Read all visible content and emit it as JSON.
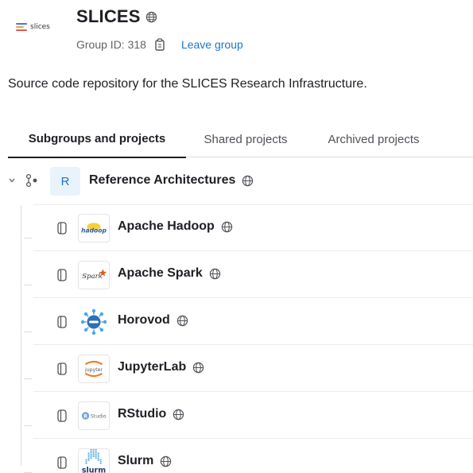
{
  "group": {
    "logo_text": "slices",
    "name": "SLICES",
    "id_label": "Group ID: 318",
    "leave_label": "Leave group",
    "description": "Source code repository for the SLICES Research Infrastructure."
  },
  "tabs": [
    {
      "label": "Subgroups and projects",
      "active": true
    },
    {
      "label": "Shared projects",
      "active": false
    },
    {
      "label": "Archived projects",
      "active": false
    }
  ],
  "subgroup": {
    "avatar_letter": "R",
    "name": "Reference Architectures"
  },
  "projects": [
    {
      "name": "Apache Hadoop",
      "logo_text": "hadoop",
      "icon": "hadoop-logo-icon"
    },
    {
      "name": "Apache Spark",
      "logo_text": "Spark",
      "icon": "spark-logo-icon"
    },
    {
      "name": "Horovod",
      "logo_text": "",
      "icon": "horovod-logo-icon"
    },
    {
      "name": "JupyterLab",
      "logo_text": "jupyter",
      "icon": "jupyter-logo-icon"
    },
    {
      "name": "RStudio",
      "logo_text": "Studio",
      "icon": "rstudio-logo-icon"
    },
    {
      "name": "Slurm",
      "logo_text": "slurm",
      "icon": "slurm-logo-icon"
    }
  ],
  "colors": {
    "link": "#1f75cb",
    "text": "#1f1e24",
    "muted": "#626168",
    "avatar_bg": "#e9f3fc"
  }
}
